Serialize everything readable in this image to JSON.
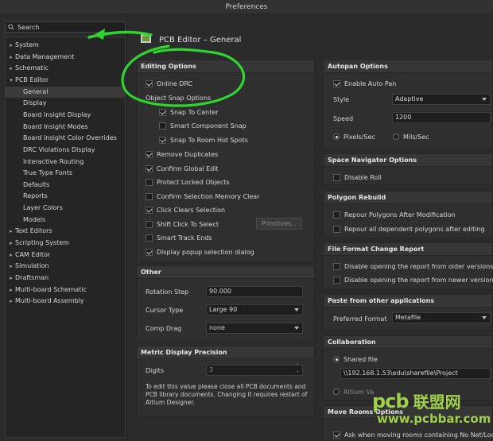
{
  "window": {
    "title": "Preferences"
  },
  "search": {
    "label": "Search",
    "placeholder": ""
  },
  "tree": [
    {
      "label": "System",
      "level": 0,
      "expanded": false
    },
    {
      "label": "Data Management",
      "level": 0,
      "expanded": false
    },
    {
      "label": "Schematic",
      "level": 0,
      "expanded": false
    },
    {
      "label": "PCB Editor",
      "level": 0,
      "expanded": true
    },
    {
      "label": "General",
      "level": 1,
      "selected": true
    },
    {
      "label": "Display",
      "level": 1
    },
    {
      "label": "Board Insight Display",
      "level": 1
    },
    {
      "label": "Board Insight Modes",
      "level": 1
    },
    {
      "label": "Board Insight Color Overrides",
      "level": 1
    },
    {
      "label": "DRC Violations Display",
      "level": 1
    },
    {
      "label": "Interactive Routing",
      "level": 1
    },
    {
      "label": "True Type Fonts",
      "level": 1
    },
    {
      "label": "Defaults",
      "level": 1
    },
    {
      "label": "Reports",
      "level": 1
    },
    {
      "label": "Layer Colors",
      "level": 1
    },
    {
      "label": "Models",
      "level": 1
    },
    {
      "label": "Text Editors",
      "level": 0,
      "expanded": false
    },
    {
      "label": "Scripting System",
      "level": 0,
      "expanded": false
    },
    {
      "label": "CAM Editor",
      "level": 0,
      "expanded": false
    },
    {
      "label": "Simulation",
      "level": 0,
      "expanded": false
    },
    {
      "label": "Draftsman",
      "level": 0,
      "expanded": false
    },
    {
      "label": "Multi-board Schematic",
      "level": 0,
      "expanded": false
    },
    {
      "label": "Multi-board Assembly",
      "level": 0,
      "expanded": false
    }
  ],
  "header": {
    "title": "PCB Editor – General"
  },
  "editing": {
    "title": "Editing Options",
    "online_drc": "Online DRC",
    "object_snap": "Object Snap Options",
    "snap_center": "Snap To Center",
    "smart_snap": "Smart Component Snap",
    "snap_hot": "Snap To Room Hot Spots",
    "remove_dup": "Remove Duplicates",
    "confirm_global": "Confirm Global Edit",
    "protect_locked": "Protect Locked Objects",
    "confirm_sel_mem": "Confirm Selection Memory Clear",
    "click_clears": "Click Clears Selection",
    "shift_click": "Shift Click To Select",
    "primitives_btn": "Primitives...",
    "smart_track": "Smart Track Ends",
    "display_popup": "Display popup selection dialog"
  },
  "other": {
    "title": "Other",
    "rotation_label": "Rotation Step",
    "rotation_value": "90.000",
    "cursor_label": "Cursor Type",
    "cursor_value": "Large 90",
    "comp_drag_label": "Comp Drag",
    "comp_drag_value": "none"
  },
  "metric": {
    "title": "Metric Display Precision",
    "digits_label": "Digits",
    "digits_value": "3",
    "note": "To edit this value please close all PCB documents and PCB library documents. Changing it requires restart of Altium Designer."
  },
  "autopan": {
    "title": "Autopan Options",
    "enable": "Enable Auto Pan",
    "style_label": "Style",
    "style_value": "Adaptive",
    "speed_label": "Speed",
    "speed_value": "1200",
    "pixels": "Pixels/Sec",
    "mils": "Mils/Sec"
  },
  "space_nav": {
    "title": "Space Navigator Options",
    "disable_roll": "Disable Roll"
  },
  "polygon": {
    "title": "Polygon Rebuild",
    "repour_after": "Repour Polygons After Modification",
    "repour_all": "Repour all dependent polygons after editing"
  },
  "ffcr": {
    "title": "File Format Change Report",
    "older": "Disable opening the report from older versions",
    "newer": "Disable opening the report from newer versions"
  },
  "paste": {
    "title": "Paste from other applications",
    "pref_label": "Preferred Format",
    "pref_value": "Metafile"
  },
  "collab": {
    "title": "Collaboration",
    "shared_file": "Shared file",
    "path": "\\\\192.168.1.53\\edu\\sharefile\\Project",
    "altium_vault": "Altium Va"
  },
  "move_rooms": {
    "title": "Move Rooms Options",
    "ask": "Ask when moving rooms containing No Net/Locke"
  },
  "watermark": {
    "pcb": "pcb",
    "cn": "联盟网",
    "url": "www.pcbbar.com"
  },
  "colors": {
    "accent_green": "#2fd42f",
    "watermark_green": "#9fd04a"
  }
}
